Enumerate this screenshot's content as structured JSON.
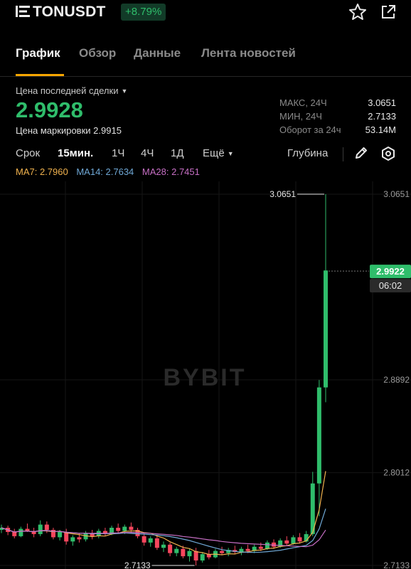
{
  "header": {
    "pair": "TONUSDT",
    "change": "+8.79%",
    "icons": [
      "menu-icon",
      "star-icon",
      "share-icon"
    ]
  },
  "tabs": [
    {
      "label": "График",
      "active": true
    },
    {
      "label": "Обзор",
      "active": false
    },
    {
      "label": "Данные",
      "active": false
    },
    {
      "label": "Лента новостей",
      "active": false
    }
  ],
  "ticker": {
    "last_label": "Цена последней сделки",
    "last_price": "2.9928",
    "mark_label": "Цена маркировки",
    "mark_price": "2.9915"
  },
  "stats": [
    {
      "label": "МАКС, 24Ч",
      "value": "3.0651"
    },
    {
      "label": "МИН, 24Ч",
      "value": "2.7133"
    },
    {
      "label": "Оборот за 24ч",
      "value": "53.14M"
    }
  ],
  "toolbar": {
    "items": [
      {
        "label": "Срок",
        "active": false
      },
      {
        "label": "15мин.",
        "active": true
      },
      {
        "label": "1Ч",
        "active": false
      },
      {
        "label": "4Ч",
        "active": false
      },
      {
        "label": "1Д",
        "active": false
      },
      {
        "label": "Ещё",
        "active": false
      }
    ],
    "depth": "Глубина"
  },
  "ma": [
    {
      "label": "MA7: 2.7960",
      "color": "#f0b24e"
    },
    {
      "label": "MA14: 2.7634",
      "color": "#6fa8d6"
    },
    {
      "label": "MA28: 2.7451",
      "color": "#c76fc5"
    }
  ],
  "colors": {
    "up": "#2fbd6b",
    "down": "#f6465d",
    "accent": "#f7a600"
  },
  "chart_data": {
    "type": "candlestick",
    "watermark": "BYBIT",
    "y_ticks": [
      "3.0651",
      "2.8892",
      "2.8012",
      "2.7133"
    ],
    "y_tick_values": [
      3.0651,
      2.8892,
      2.8012,
      2.7133
    ],
    "ylim": [
      2.7133,
      3.0651
    ],
    "high_label": "3.0651",
    "low_label": "2.7133",
    "current_price": "2.9922",
    "current_price_value": 2.9922,
    "countdown": "06:02",
    "candles": [
      [
        2.747,
        2.752,
        2.744,
        2.749
      ],
      [
        2.749,
        2.751,
        2.742,
        2.745
      ],
      [
        2.745,
        2.748,
        2.739,
        2.741
      ],
      [
        2.741,
        2.75,
        2.74,
        2.748
      ],
      [
        2.748,
        2.753,
        2.745,
        2.746
      ],
      [
        2.746,
        2.749,
        2.74,
        2.743
      ],
      [
        2.743,
        2.756,
        2.741,
        2.752
      ],
      [
        2.752,
        2.755,
        2.744,
        2.747
      ],
      [
        2.747,
        2.749,
        2.738,
        2.74
      ],
      [
        2.74,
        2.747,
        2.737,
        2.745
      ],
      [
        2.745,
        2.748,
        2.733,
        2.736
      ],
      [
        2.736,
        2.742,
        2.732,
        2.74
      ],
      [
        2.74,
        2.744,
        2.735,
        2.738
      ],
      [
        2.738,
        2.746,
        2.736,
        2.744
      ],
      [
        2.744,
        2.747,
        2.738,
        2.741
      ],
      [
        2.741,
        2.748,
        2.739,
        2.746
      ],
      [
        2.746,
        2.749,
        2.741,
        2.743
      ],
      [
        2.743,
        2.751,
        2.742,
        2.749
      ],
      [
        2.749,
        2.753,
        2.744,
        2.746
      ],
      [
        2.746,
        2.752,
        2.743,
        2.75
      ],
      [
        2.75,
        2.754,
        2.745,
        2.747
      ],
      [
        2.747,
        2.749,
        2.739,
        2.741
      ],
      [
        2.741,
        2.744,
        2.732,
        2.735
      ],
      [
        2.735,
        2.741,
        2.731,
        2.739
      ],
      [
        2.739,
        2.742,
        2.728,
        2.73
      ],
      [
        2.73,
        2.736,
        2.726,
        2.733
      ],
      [
        2.733,
        2.735,
        2.722,
        2.725
      ],
      [
        2.725,
        2.731,
        2.722,
        2.729
      ],
      [
        2.729,
        2.732,
        2.72,
        2.722
      ],
      [
        2.722,
        2.729,
        2.717,
        2.727
      ],
      [
        2.727,
        2.73,
        2.7133,
        2.718
      ],
      [
        2.718,
        2.726,
        2.716,
        2.724
      ],
      [
        2.724,
        2.728,
        2.719,
        2.721
      ],
      [
        2.721,
        2.729,
        2.72,
        2.727
      ],
      [
        2.727,
        2.731,
        2.723,
        2.725
      ],
      [
        2.725,
        2.73,
        2.722,
        2.728
      ],
      [
        2.728,
        2.732,
        2.724,
        2.726
      ],
      [
        2.726,
        2.731,
        2.723,
        2.729
      ],
      [
        2.729,
        2.733,
        2.725,
        2.727
      ],
      [
        2.727,
        2.733,
        2.725,
        2.731
      ],
      [
        2.731,
        2.735,
        2.727,
        2.729
      ],
      [
        2.729,
        2.737,
        2.728,
        2.735
      ],
      [
        2.735,
        2.738,
        2.729,
        2.731
      ],
      [
        2.731,
        2.739,
        2.73,
        2.737
      ],
      [
        2.737,
        2.741,
        2.732,
        2.734
      ],
      [
        2.734,
        2.742,
        2.733,
        2.74
      ],
      [
        2.74,
        2.744,
        2.734,
        2.736
      ],
      [
        2.736,
        2.746,
        2.735,
        2.743
      ],
      [
        2.743,
        2.802,
        2.741,
        2.791
      ],
      [
        2.791,
        2.889,
        2.76,
        2.882
      ],
      [
        2.882,
        3.0651,
        2.868,
        2.9928
      ]
    ]
  }
}
